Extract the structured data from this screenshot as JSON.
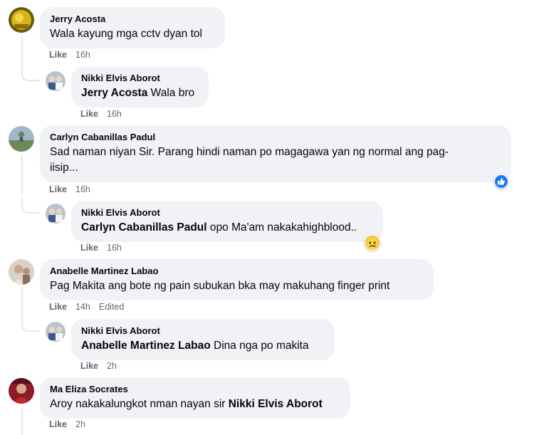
{
  "colors": {
    "bubble_bg": "#f0f2f5",
    "meta_text": "#65676b",
    "like_blue": "#1877f2",
    "line": "#e4e6eb"
  },
  "comments": [
    {
      "author": "Jerry Acosta",
      "text": "Wala kayung mga cctv dyan tol",
      "like_label": "Like",
      "time": "16h",
      "avatar_icon": "avatar-yellow-icon"
    },
    {
      "author": "Nikki Elvis Aborot",
      "mention": "Jerry Acosta",
      "text": "Wala bro",
      "like_label": "Like",
      "time": "16h",
      "avatar_icon": "avatar-group-icon"
    },
    {
      "author": "Carlyn Cabanillas Padul",
      "text_line1": "Sad naman niyan Sir. Parang hindi naman po magagawa yan ng normal ang pag-",
      "text_line2": "iisip...",
      "like_label": "Like",
      "time": "16h",
      "reaction_icon": "like-reaction-icon",
      "avatar_icon": "avatar-landscape-icon"
    },
    {
      "author": "Nikki Elvis Aborot",
      "mention": "Carlyn Cabanillas Padul",
      "text": "opo Ma'am nakakahighblood..",
      "like_label": "Like",
      "time": "16h",
      "reaction_icon": "sad-reaction-icon",
      "avatar_icon": "avatar-group-icon"
    },
    {
      "author": "Anabelle Martinez Labao",
      "text": "Pag Makita ang bote ng pain subukan bka may makuhang finger print",
      "like_label": "Like",
      "time": "14h",
      "edited_label": "Edited",
      "avatar_icon": "avatar-person-icon"
    },
    {
      "author": "Nikki Elvis Aborot",
      "mention": "Anabelle Martinez Labao",
      "text": "Dina nga po makita",
      "like_label": "Like",
      "time": "2h",
      "avatar_icon": "avatar-group-icon"
    },
    {
      "author": "Ma Eliza Socrates",
      "text": "Aroy nakakalungkot nman nayan sir",
      "mention_end": "Nikki Elvis Aborot",
      "like_label": "Like",
      "time": "2h",
      "avatar_icon": "avatar-red-icon"
    }
  ]
}
